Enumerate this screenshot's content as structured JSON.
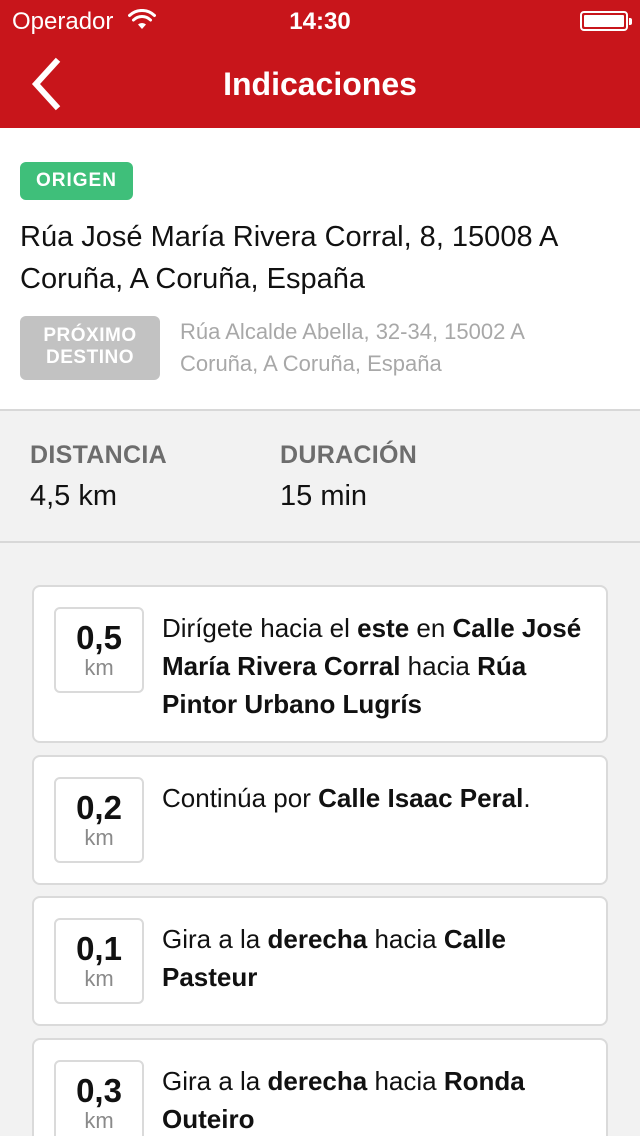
{
  "status_bar": {
    "carrier": "Operador",
    "time": "14:30",
    "wifi_icon": "wifi-icon",
    "battery_icon": "battery-icon"
  },
  "nav": {
    "back_icon": "chevron-left-icon",
    "title": "Indicaciones"
  },
  "origin": {
    "badge": "ORIGEN",
    "address": "Rúa José María Rivera Corral, 8, 15008 A Coruña, A Coruña, España"
  },
  "next_destination": {
    "badge_line1": "PRÓXIMO",
    "badge_line2": "DESTINO",
    "address": "Rúa Alcalde Abella, 32-34, 15002 A Coruña, A Coruña, España"
  },
  "summary": {
    "distance_label": "DISTANCIA",
    "distance_value": "4,5 km",
    "duration_label": "DURACIÓN",
    "duration_value": "15 min"
  },
  "steps": [
    {
      "distance": "0,5",
      "unit": "km",
      "parts": [
        {
          "text": "Dirígete hacia el ",
          "bold": false
        },
        {
          "text": "este",
          "bold": true
        },
        {
          "text": " en ",
          "bold": false
        },
        {
          "text": "Calle José María Rivera Corral",
          "bold": true
        },
        {
          "text": " hacia ",
          "bold": false
        },
        {
          "text": "Rúa Pintor Urbano Lugrís",
          "bold": true
        }
      ]
    },
    {
      "distance": "0,2",
      "unit": "km",
      "parts": [
        {
          "text": "Continúa por ",
          "bold": false
        },
        {
          "text": "Calle Isaac Peral",
          "bold": true
        },
        {
          "text": ".",
          "bold": false
        }
      ]
    },
    {
      "distance": "0,1",
      "unit": "km",
      "parts": [
        {
          "text": "Gira a la ",
          "bold": false
        },
        {
          "text": "derecha",
          "bold": true
        },
        {
          "text": " hacia ",
          "bold": false
        },
        {
          "text": "Calle Pasteur",
          "bold": true
        }
      ]
    },
    {
      "distance": "0,3",
      "unit": "km",
      "parts": [
        {
          "text": "Gira a la ",
          "bold": false
        },
        {
          "text": "derecha",
          "bold": true
        },
        {
          "text": " hacia ",
          "bold": false
        },
        {
          "text": "Ronda Outeiro",
          "bold": true
        }
      ]
    }
  ],
  "colors": {
    "brand_red": "#c8151b",
    "origin_green": "#3fbf7a",
    "badge_gray": "#c2c2c2"
  }
}
